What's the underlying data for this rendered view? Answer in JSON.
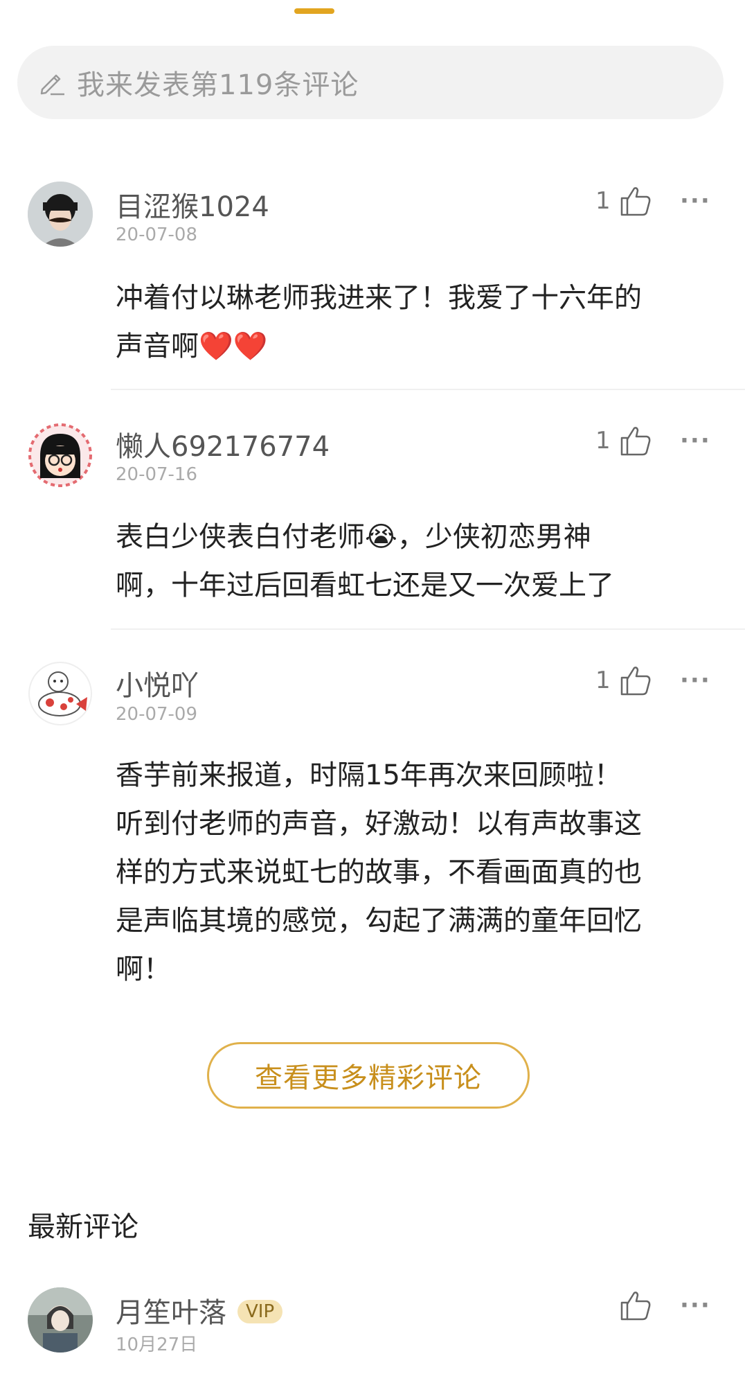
{
  "header": {
    "comment_placeholder": "我来发表第119条评论"
  },
  "comments": [
    {
      "username": "目涩猴1024",
      "date": "20-07-08",
      "likes": "1",
      "text_lines": [
        "冲着付以琳老师我进来了！我爱了十六年的",
        "声音啊"
      ],
      "emoji": "❤️❤️"
    },
    {
      "username": "懒人692176774",
      "date": "20-07-16",
      "likes": "1",
      "text_lines": [
        "表白少侠表白付老师😭，少侠初恋男神",
        "啊，十年过后回看虹七还是又一次爱上了"
      ]
    },
    {
      "username": "小悦吖",
      "date": "20-07-09",
      "likes": "1",
      "text_lines": [
        "香芋前来报道，时隔15年再次来回顾啦！",
        "听到付老师的声音，好激动！以有声故事这",
        "样的方式来说虹七的故事，不看画面真的也",
        "是声临其境的感觉，勾起了满满的童年回忆",
        "啊！"
      ]
    }
  ],
  "more_button_label": "查看更多精彩评论",
  "latest_section_title": "最新评论",
  "latest_comment": {
    "username": "月笙叶落",
    "badge": "VIP",
    "date": "10月27日"
  },
  "more_menu_label": "···",
  "icons": {
    "pencil": "pencil-icon",
    "thumb": "thumbs-up-icon",
    "more": "more-dots-icon"
  },
  "colors": {
    "accent": "#e2a520",
    "more_button_border": "#e0b14b",
    "more_button_text": "#c88f1c"
  }
}
